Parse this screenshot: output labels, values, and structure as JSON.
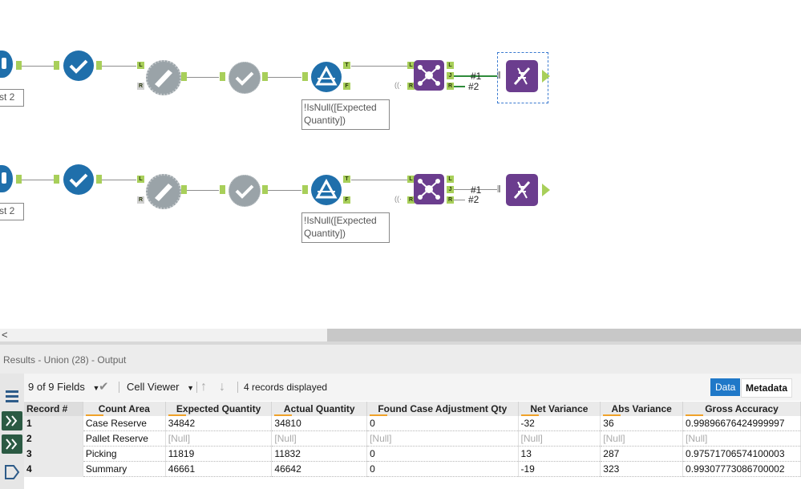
{
  "canvas": {
    "rows": [
      {
        "partial_label": "st 2",
        "filter_annotation": "!IsNull([Expected Quantity])",
        "out1": "#1",
        "out2": "#2"
      },
      {
        "partial_label": "st 2",
        "filter_annotation": "!IsNull([Expected Quantity])",
        "out1": "#1",
        "out2": "#2"
      }
    ],
    "anchor_T": "T",
    "anchor_F": "F",
    "anchor_L": "L",
    "anchor_R": "R",
    "anchor_J": "J",
    "join_bracket": "((·"
  },
  "scrollbar": {
    "left_arrow": "<"
  },
  "results": {
    "title": "Results - Union (28) - Output",
    "fields_selector": "9 of 9 Fields",
    "viewer": "Cell Viewer",
    "records_text": "4 records displayed",
    "tab_data": "Data",
    "tab_metadata": "Metadata"
  },
  "table": {
    "columns": [
      "Record #",
      "Count Area",
      "Expected Quantity",
      "Actual Quantity",
      "Found Case Adjustment Qty",
      "Net Variance",
      "Abs Variance",
      "Gross Accuracy"
    ],
    "rows": [
      [
        "1",
        "Case Reserve",
        "34842",
        "34810",
        "0",
        "-32",
        "36",
        "0.99896676424999997"
      ],
      [
        "2",
        "Pallet Reserve",
        "[Null]",
        "[Null]",
        "[Null]",
        "[Null]",
        "[Null]",
        "[Null]"
      ],
      [
        "3",
        "Picking",
        "11819",
        "11832",
        "0",
        "13",
        "287",
        "0.97571706574100003"
      ],
      [
        "4",
        "Summary",
        "46661",
        "46642",
        "0",
        "-19",
        "323",
        "0.99307773086700002"
      ]
    ]
  },
  "colors": {
    "blue_tool": "#1f6fab",
    "gray_tool": "#9aa3a8",
    "purple_tool": "#6b3d8e",
    "anchor_green": "#a8cf5a",
    "accent_orange": "#f0a22a",
    "data_tab_blue": "#1f78c8"
  }
}
